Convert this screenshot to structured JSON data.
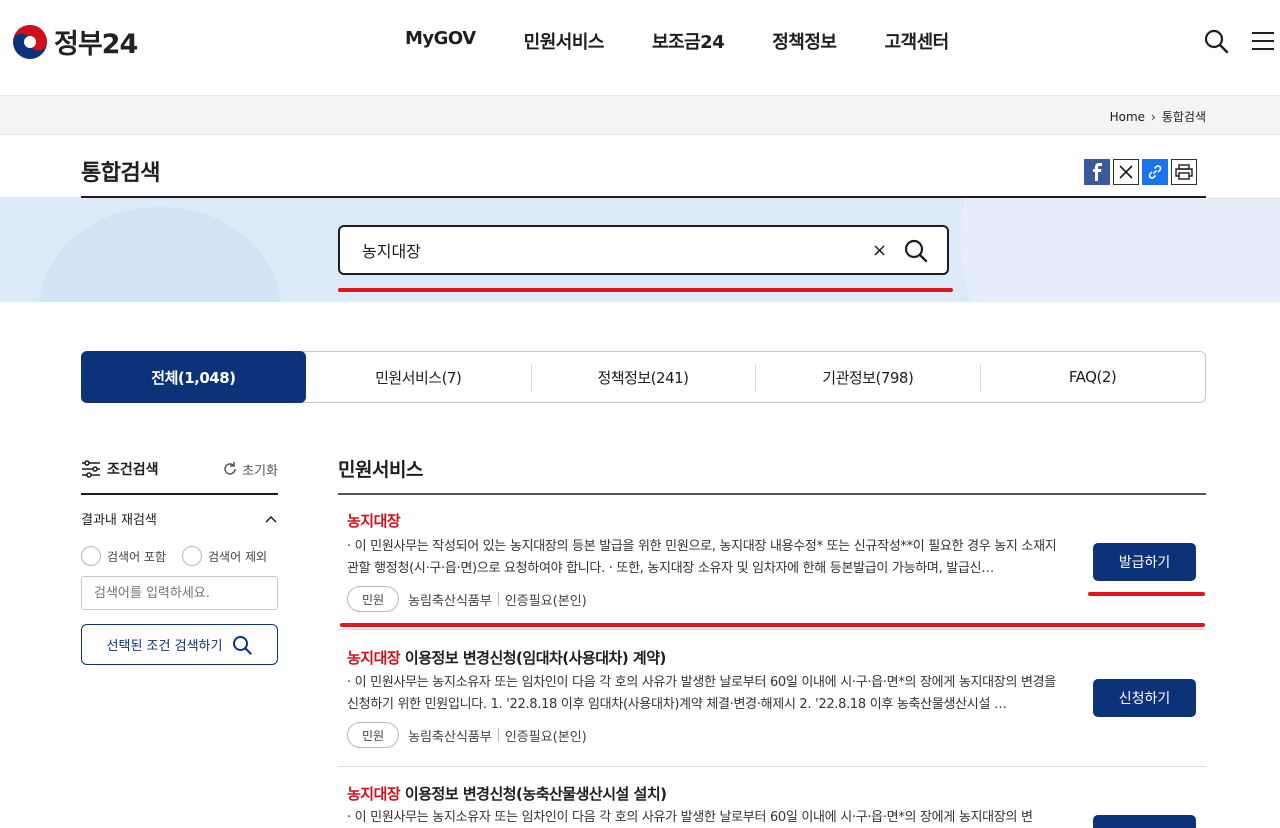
{
  "header": {
    "logo_text": "정부24",
    "nav": [
      "MyGOV",
      "민원서비스",
      "보조금24",
      "정책정보",
      "고객센터"
    ],
    "icons": [
      "search-icon",
      "menu-icon"
    ]
  },
  "breadcrumb": {
    "home": "Home",
    "current": "통합검색"
  },
  "page": {
    "title": "통합검색"
  },
  "share_icons": [
    "facebook-icon",
    "x-icon",
    "link-icon",
    "print-icon"
  ],
  "search": {
    "value": "농지대장",
    "clear_glyph": "×"
  },
  "tabs": [
    {
      "label": "전체(1,048)",
      "active": true
    },
    {
      "label": "민원서비스(7)",
      "active": false
    },
    {
      "label": "정책정보(241)",
      "active": false
    },
    {
      "label": "기관정보(798)",
      "active": false
    },
    {
      "label": "FAQ(2)",
      "active": false
    }
  ],
  "filter": {
    "title": "조건검색",
    "reset": "초기화",
    "refine_label": "결과내 재검색",
    "include_label": "검색어 포함",
    "exclude_label": "검색어 제외",
    "input_placeholder": "검색어를 입력하세요.",
    "submit_label": "선택된 조건 검색하기"
  },
  "results": {
    "section_title": "민원서비스",
    "items": [
      {
        "highlight": "농지대장",
        "title_rest": "",
        "desc": "· 이 민원사무는 작성되어 있는 농지대장의 등본 발급을 위한 민원으로, 농지대장 내용수정* 또는 신규작성**이 필요한 경우 농지 소재지 관할 행정청(시·구·읍·면)으로 요청하여야 합니다. · 또한, 농지대장 소유자 및 임차자에 한해 등본발급이 가능하며, 발급신…",
        "tag": "민원",
        "agency": "농림축산식품부",
        "auth": "인증필요(본인)",
        "button": "발급하기"
      },
      {
        "highlight": "농지대장",
        "title_rest": " 이용정보 변경신청(임대차(사용대차) 계약)",
        "desc": "· 이 민원사무는 농지소유자 또는 임차인이 다음 각 호의 사유가 발생한 날로부터 60일 이내에 시·구·읍·면*의 장에게 농지대장의 변경을 신청하기 위한 민원입니다. 1. '22.8.18 이후 임대차(사용대차)계약 체결·변경·해제시 2. '22.8.18 이후 농축산물생산시설 …",
        "tag": "민원",
        "agency": "농림축산식품부",
        "auth": "인증필요(본인)",
        "button": "신청하기"
      },
      {
        "highlight": "농지대장",
        "title_rest": " 이용정보 변경신청(농축산물생산시설 설치)",
        "desc": "· 이 민원사무는 농지소유자 또는 임차인이 다음 각 호의 사유가 발생한 날로부터 60일 이내에 시·구·읍·면*의 장에게 농지대장의 변",
        "tag": "",
        "agency": "",
        "auth": "",
        "button": ""
      }
    ]
  },
  "colors": {
    "primary": "#0c3279",
    "highlight": "#d0111b",
    "annotation_red": "#e3141a"
  }
}
